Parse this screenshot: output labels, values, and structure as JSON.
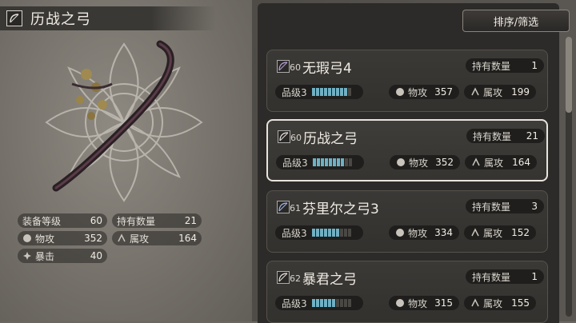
{
  "selected": {
    "title": "历战之弓",
    "stats": {
      "equip_level_label": "装备等级",
      "equip_level": "60",
      "owned_label": "持有数量",
      "owned": "21",
      "attack_label": "物攻",
      "attack": "352",
      "element_label": "属攻",
      "element": "164",
      "crit_label": "暴击",
      "crit": "40"
    }
  },
  "sort_button": "排序/筛选",
  "list": [
    {
      "level": "60",
      "name": "无瑕弓4",
      "owned_label": "持有数量",
      "owned": "1",
      "grade_label": "品级3",
      "grade_fill": 9,
      "attack_label": "物攻",
      "attack": "357",
      "element_label": "属攻",
      "element": "199",
      "icon_color": "#b8a0d8"
    },
    {
      "level": "60",
      "name": "历战之弓",
      "owned_label": "持有数量",
      "owned": "21",
      "grade_label": "品级3",
      "grade_fill": 8,
      "attack_label": "物攻",
      "attack": "352",
      "element_label": "属攻",
      "element": "164",
      "icon_color": "#e8e4dc"
    },
    {
      "level": "61",
      "name": "芬里尔之弓3",
      "owned_label": "持有数量",
      "owned": "3",
      "grade_label": "品级3",
      "grade_fill": 7,
      "attack_label": "物攻",
      "attack": "334",
      "element_label": "属攻",
      "element": "152",
      "icon_color": "#a0b8e8"
    },
    {
      "level": "62",
      "name": "暴君之弓",
      "owned_label": "持有数量",
      "owned": "1",
      "grade_label": "品级3",
      "grade_fill": 6,
      "attack_label": "物攻",
      "attack": "315",
      "element_label": "属攻",
      "element": "155",
      "icon_color": "#e8e4dc"
    }
  ],
  "colors": {
    "grade_bar": "#6fb0c4",
    "panel": "#2d2b29"
  }
}
